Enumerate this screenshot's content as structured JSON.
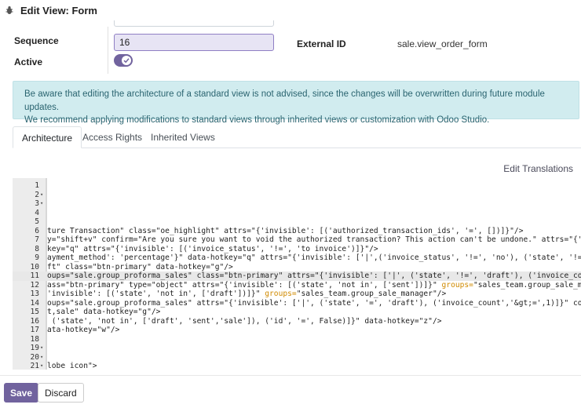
{
  "header": {
    "title": "Edit View: Form",
    "icon": "bug-icon"
  },
  "form": {
    "sequence_label": "Sequence",
    "sequence_value": "16",
    "active_label": "Active",
    "active_state": true,
    "external_id_label": "External ID",
    "external_id_value": "sale.view_order_form"
  },
  "alert": {
    "line1": "Be aware that editing the architecture of a standard view is not advised, since the changes will be overwritten during future module updates.",
    "line2": "We recommend applying modifications to standard views through inherited views or customization with Odoo Studio."
  },
  "tabs": [
    {
      "label": "Architecture"
    },
    {
      "label": "Access Rights"
    },
    {
      "label": "Inherited Views"
    }
  ],
  "edit_translations": "Edit Translations",
  "code": {
    "lines": [
      {
        "n": "1",
        "fold": false,
        "text": ""
      },
      {
        "n": "2",
        "fold": true,
        "text": ""
      },
      {
        "n": "3",
        "fold": true,
        "text": ""
      },
      {
        "n": "4",
        "fold": false,
        "text": ""
      },
      {
        "n": "5",
        "fold": false,
        "text": ""
      },
      {
        "n": "6",
        "fold": false,
        "text": "ture Transaction\" class=\"oe_highlight\" attrs=\"{'invisible': [('authorized_transaction_ids', '=', [])]}\"/>"
      },
      {
        "n": "7",
        "fold": false,
        "text": "y=\"shift+v\" confirm=\"Are you sure you want to void the authorized transaction? This action can't be undone.\" attrs=\"{'invisible'"
      },
      {
        "n": "8",
        "fold": false,
        "text": "key=\"q\" attrs=\"{'invisible': [('invoice_status', '!=', 'to invoice')]}\"/>"
      },
      {
        "n": "9",
        "fold": false,
        "text": "ayment_method': 'percentage'}\" data-hotkey=\"q\" attrs=\"{'invisible': ['|',('invoice_status', '!=', 'no'), ('state', '!=', 'sale')"
      },
      {
        "n": "10",
        "fold": false,
        "text": "ft\" class=\"btn-primary\" data-hotkey=\"g\"/>"
      },
      {
        "n": "11",
        "fold": false,
        "text": "oups=\"sale.group_proforma_sales\" class=\"btn-primary\" attrs=\"{'invisible': ['|', ('state', '!=', 'draft'), ('invoice_count','&gt;"
      },
      {
        "n": "12",
        "fold": false,
        "text": "ass=\"btn-primary\" type=\"object\" attrs=\"{'invisible': [('state', 'not in', ['sent'])]}\" groups=\"sales_team.group_sale_manager\"/>"
      },
      {
        "n": "13",
        "fold": false,
        "text": "'invisible': [('state', 'not in', ['draft'])]}\" groups=\"sales_team.group_sale_manager\"/>"
      },
      {
        "n": "14",
        "fold": false,
        "text": "oups=\"sale.group_proforma_sales\" attrs=\"{'invisible': ['|', ('state', '=', 'draft'), ('invoice_count','&gt;=',1)]}\" context=\"{'p"
      },
      {
        "n": "15",
        "fold": false,
        "text": "t,sale\" data-hotkey=\"g\"/>"
      },
      {
        "n": "16",
        "fold": false,
        "text": " ('state', 'not in', ['draft', 'sent','sale']), ('id', '=', False)]}\" data-hotkey=\"z\"/>"
      },
      {
        "n": "17",
        "fold": false,
        "text": "ata-hotkey=\"w\"/>"
      },
      {
        "n": "18",
        "fold": false,
        "text": ""
      },
      {
        "n": "19",
        "fold": true,
        "text": ""
      },
      {
        "n": "20",
        "fold": true,
        "text": ""
      },
      {
        "n": "21",
        "fold": true,
        "text": "lobe icon\">"
      }
    ],
    "highlighted_line": "11"
  },
  "footer": {
    "save_label": "Save",
    "discard_label": "Discard"
  },
  "colors": {
    "accent": "#71639e",
    "alert_bg": "#d1ecef",
    "alert_text": "#2a6470",
    "input_bg": "#e7e4f4"
  }
}
